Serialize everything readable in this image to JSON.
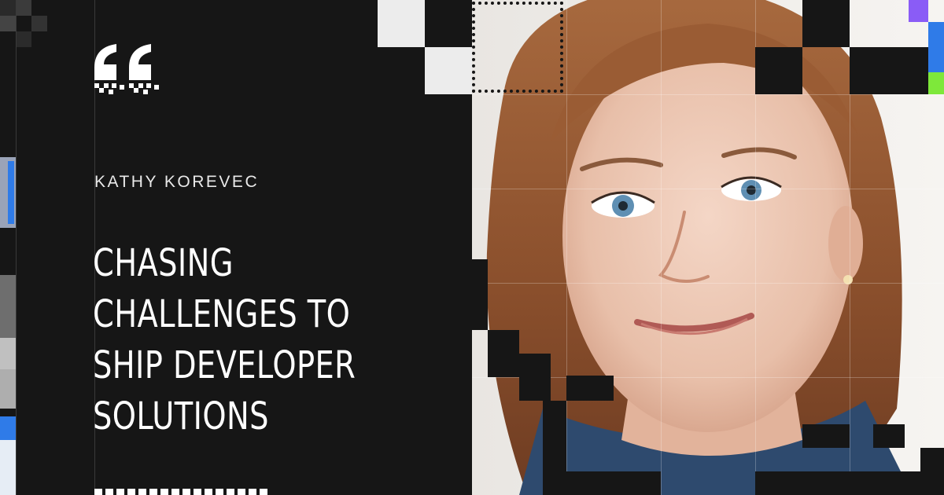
{
  "speaker_name": "KATHY KOREVEC",
  "headline_lines": [
    "CHASING",
    "CHALLENGES TO",
    "SHIP DEVELOPER",
    "SOLUTIONS"
  ],
  "icons": {
    "quote": "quotation-mark-icon"
  },
  "colors": {
    "background": "#161616",
    "text": "#ffffff",
    "accent_purple": "#8a5cf6",
    "accent_green": "#7ee83a",
    "accent_blue": "#2f7be8"
  },
  "portrait": {
    "subject": "photo-portrait"
  }
}
